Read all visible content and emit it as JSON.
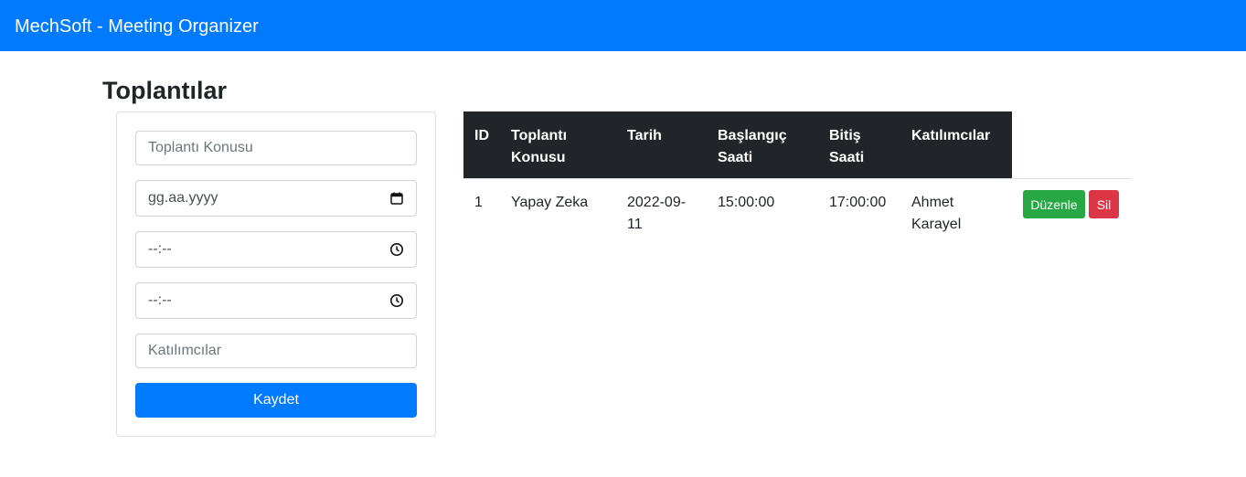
{
  "app": {
    "brand": "MechSoft - Meeting Organizer"
  },
  "page": {
    "title": "Toplantılar"
  },
  "form": {
    "subject_placeholder": "Toplantı Konusu",
    "date_placeholder": "gg.aa.yyyy",
    "start_time_placeholder": "--:--",
    "end_time_placeholder": "--:--",
    "participants_placeholder": "Katılımcılar",
    "save_label": "Kaydet"
  },
  "table": {
    "headers": {
      "id": "ID",
      "subject": [
        "Toplantı",
        "Konusu"
      ],
      "date": "Tarih",
      "start": [
        "Başlangıç",
        "Saati"
      ],
      "end": [
        "Bitiş",
        "Saati"
      ],
      "participants": "Katılımcılar"
    },
    "rows": [
      {
        "id": "1",
        "subject": "Yapay Zeka",
        "date": [
          "2022-09-",
          "11"
        ],
        "start": "15:00:00",
        "end": "17:00:00",
        "participants": [
          "Ahmet",
          "Karayel"
        ],
        "edit_label": "Düzenle",
        "delete_label": "Sil"
      }
    ]
  },
  "icons": {
    "date": "calendar-icon",
    "time": "clock-icon"
  },
  "colors": {
    "primary": "#007bff",
    "table_header": "#212529",
    "success": "#28a745",
    "danger": "#dc3545"
  }
}
